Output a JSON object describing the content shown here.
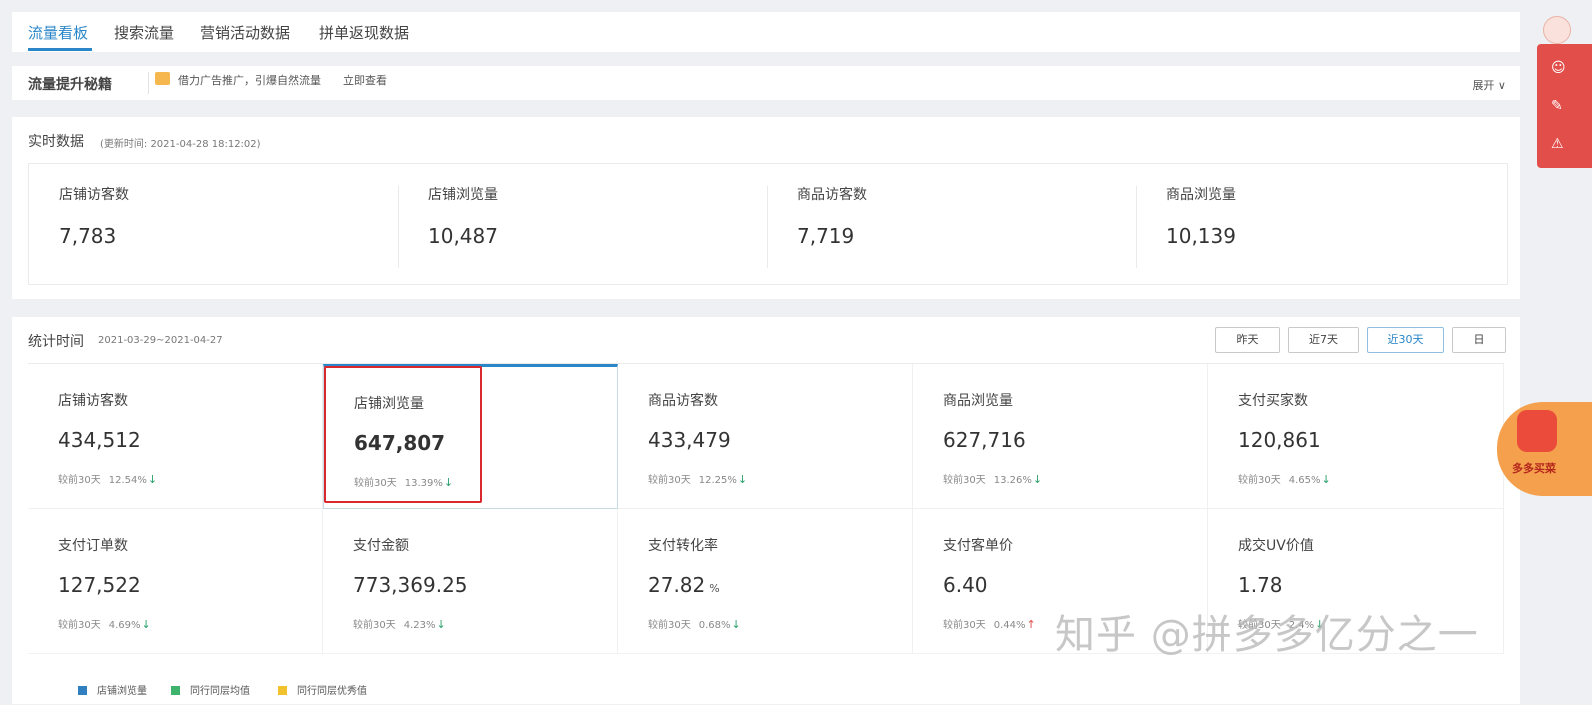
{
  "tabs": [
    "流量看板",
    "搜索流量",
    "营销活动数据",
    "拼单返现数据"
  ],
  "tips": {
    "title": "流量提升秘籍",
    "promo": "借力广告推广，引爆自然流量",
    "view_link": "立即查看",
    "expand": "展开 ∨"
  },
  "realtime": {
    "title": "实时数据",
    "updated": "(更新时间: 2021-04-28 18:12:02)",
    "metrics": [
      {
        "label": "店铺访客数",
        "value": "7,783"
      },
      {
        "label": "店铺浏览量",
        "value": "10,487"
      },
      {
        "label": "商品访客数",
        "value": "7,719"
      },
      {
        "label": "商品浏览量",
        "value": "10,139"
      }
    ]
  },
  "stats": {
    "title": "统计时间",
    "range": "2021-03-29~2021-04-27",
    "buttons": [
      "昨天",
      "近7天",
      "近30天",
      "日"
    ],
    "compare_label": "较前30天",
    "metrics": [
      {
        "label": "店铺访客数",
        "value": "434,512",
        "pct": "12.54%",
        "trend": "↓"
      },
      {
        "label": "店铺浏览量",
        "value": "647,807",
        "pct": "13.39%",
        "trend": "↓"
      },
      {
        "label": "商品访客数",
        "value": "433,479",
        "pct": "12.25%",
        "trend": "↓"
      },
      {
        "label": "商品浏览量",
        "value": "627,716",
        "pct": "13.26%",
        "trend": "↓"
      },
      {
        "label": "支付买家数",
        "value": "120,861",
        "pct": "4.65%",
        "trend": "↓"
      },
      {
        "label": "支付订单数",
        "value": "127,522",
        "pct": "4.69%",
        "trend": "↓"
      },
      {
        "label": "支付金额",
        "value": "773,369.25",
        "pct": "4.23%",
        "trend": "↓"
      },
      {
        "label": "支付转化率",
        "value": "27.82",
        "unit": "%",
        "pct": "0.68%",
        "trend": "↓"
      },
      {
        "label": "支付客单价",
        "value": "6.40",
        "pct": "0.44%",
        "trend": "↑"
      },
      {
        "label": "成交UV价值",
        "value": "1.78",
        "pct": "2.4%",
        "trend": "↓"
      }
    ],
    "legend": [
      {
        "label": "店铺浏览量",
        "color": "#2f7fc1"
      },
      {
        "label": "同行同层均值",
        "color": "#3db36b"
      },
      {
        "label": "同行同层优秀值",
        "color": "#f2c12e"
      }
    ]
  },
  "promo_badge": "多多买菜",
  "watermark": "知乎 @拼多多亿分之一",
  "colors": {
    "accent": "#2a86c8",
    "highlight": "#d9292f",
    "down": "#2aa06a",
    "up": "#e1494e"
  }
}
